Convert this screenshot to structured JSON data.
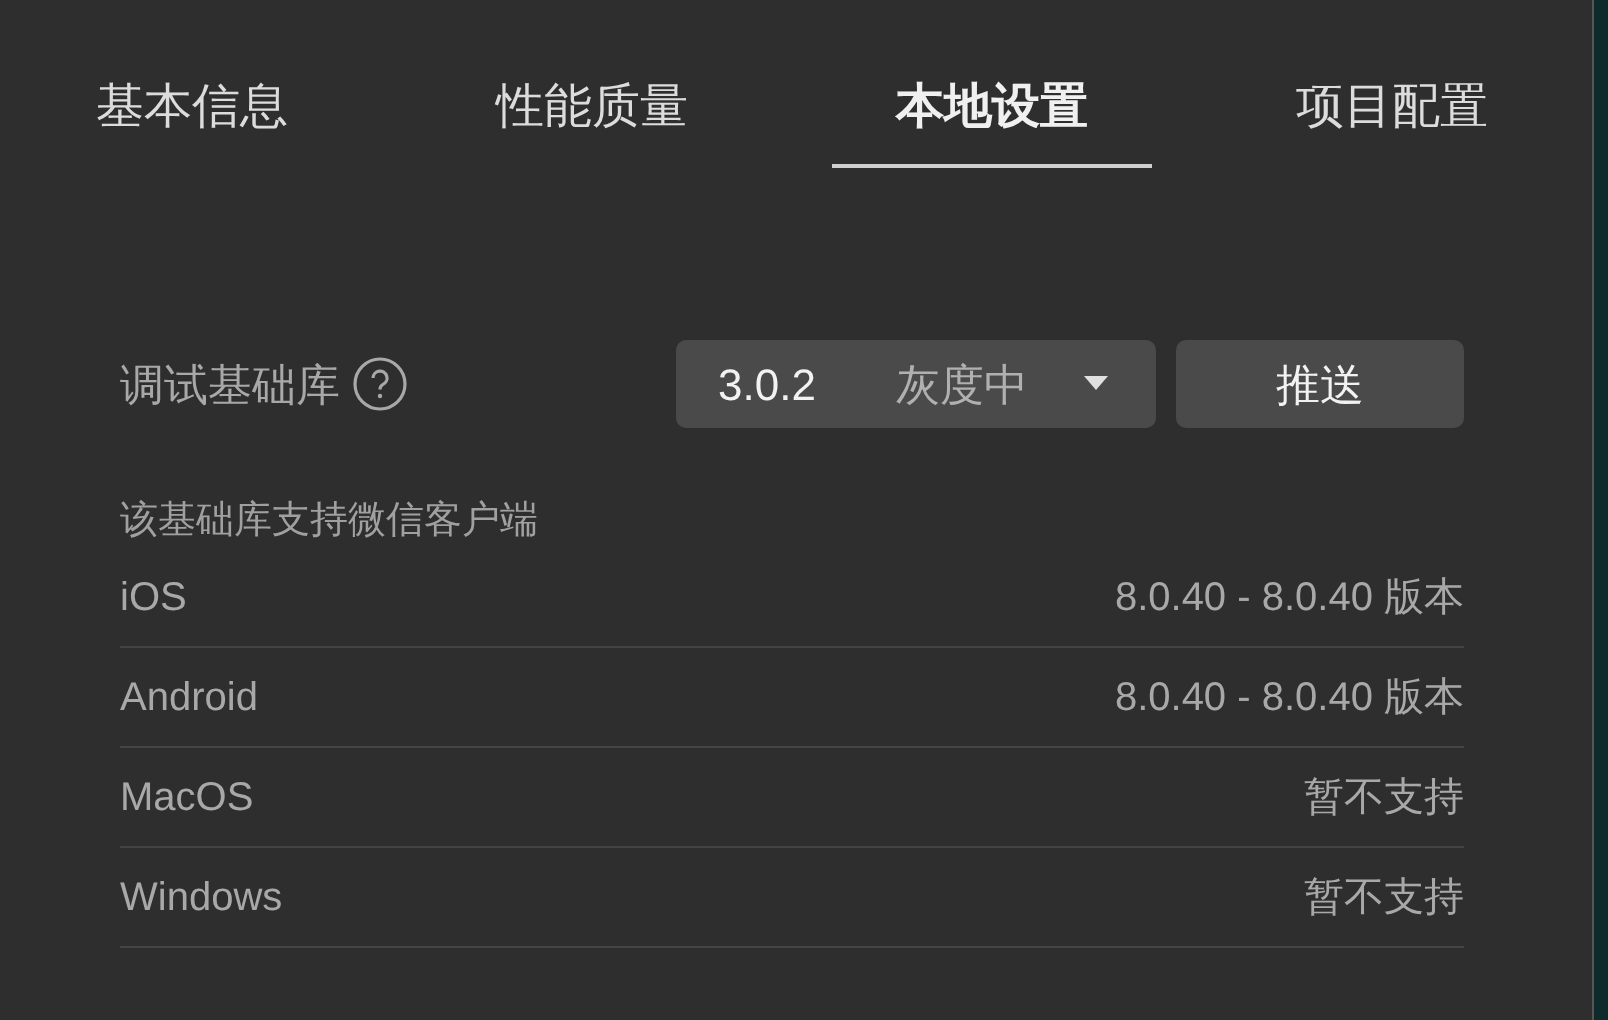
{
  "tabs": [
    {
      "label": "基本信息",
      "selected": false
    },
    {
      "label": "性能质量",
      "selected": false
    },
    {
      "label": "本地设置",
      "selected": true
    },
    {
      "label": "项目配置",
      "selected": false
    }
  ],
  "library": {
    "label": "调试基础库",
    "version": "3.0.2",
    "status": "灰度中",
    "button": "推送"
  },
  "support_title": "该基础库支持微信客户端",
  "support_rows": [
    {
      "platform": "iOS",
      "value": "8.0.40 - 8.0.40 版本"
    },
    {
      "platform": "Android",
      "value": "8.0.40 - 8.0.40 版本"
    },
    {
      "platform": "MacOS",
      "value": "暂不支持"
    },
    {
      "platform": "Windows",
      "value": "暂不支持"
    }
  ]
}
